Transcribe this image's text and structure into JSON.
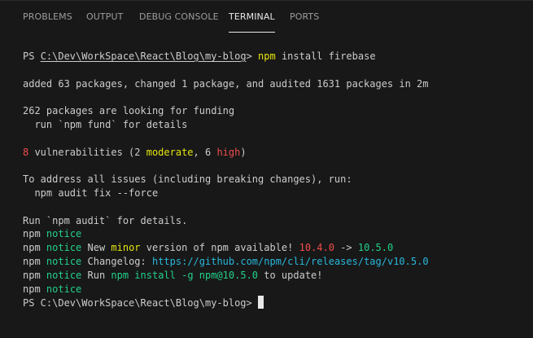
{
  "tabs": [
    {
      "label": "PROBLEMS",
      "active": false
    },
    {
      "label": "OUTPUT",
      "active": false
    },
    {
      "label": "DEBUG CONSOLE",
      "active": false
    },
    {
      "label": "TERMINAL",
      "active": true
    },
    {
      "label": "PORTS",
      "active": false
    }
  ],
  "terminal": {
    "prompt_prefix": "PS ",
    "prompt_path": "C:\\Dev\\WorkSpace\\React\\Blog\\my-blog",
    "prompt_suffix": ">",
    "command_exe": "npm",
    "command_args": " install firebase",
    "added_line": "added 63 packages, changed 1 package, and audited 1631 packages in 2m",
    "funding_line1": "262 packages are looking for funding",
    "funding_line2": "  run `npm fund` for details",
    "vuln_count": "8",
    "vuln_text1": " vulnerabilities (2 ",
    "vuln_moderate": "moderate",
    "vuln_text2": ", 6 ",
    "vuln_high": "high",
    "vuln_text3": ")",
    "address_line1": "To address all issues (including breaking changes), run:",
    "address_line2": "  npm audit fix --force",
    "run_audit_line": "Run `npm audit` for details.",
    "npm_label": "npm",
    "notice_label": "notice",
    "notice_new_text1": " New ",
    "notice_new_minor": "minor",
    "notice_new_text2": " version of npm available! ",
    "notice_old_version": "10.4.0",
    "notice_arrow": " -> ",
    "notice_new_version": "10.5.0",
    "notice_changelog_label": " Changelog: ",
    "notice_changelog_url": "https://github.com/npm/cli/releases/tag/v10.5.0",
    "notice_run_text": " Run ",
    "notice_run_command": "npm install -g npm@10.5.0",
    "notice_run_suffix": " to update!",
    "final_prompt": "PS C:\\Dev\\WorkSpace\\React\\Blog\\my-blog> "
  },
  "colors": {
    "background": "#181818",
    "text": "#cccccc",
    "yellow": "#e5e510",
    "red": "#f14c4c",
    "cyan": "#29b8db",
    "green": "#23d18b"
  }
}
